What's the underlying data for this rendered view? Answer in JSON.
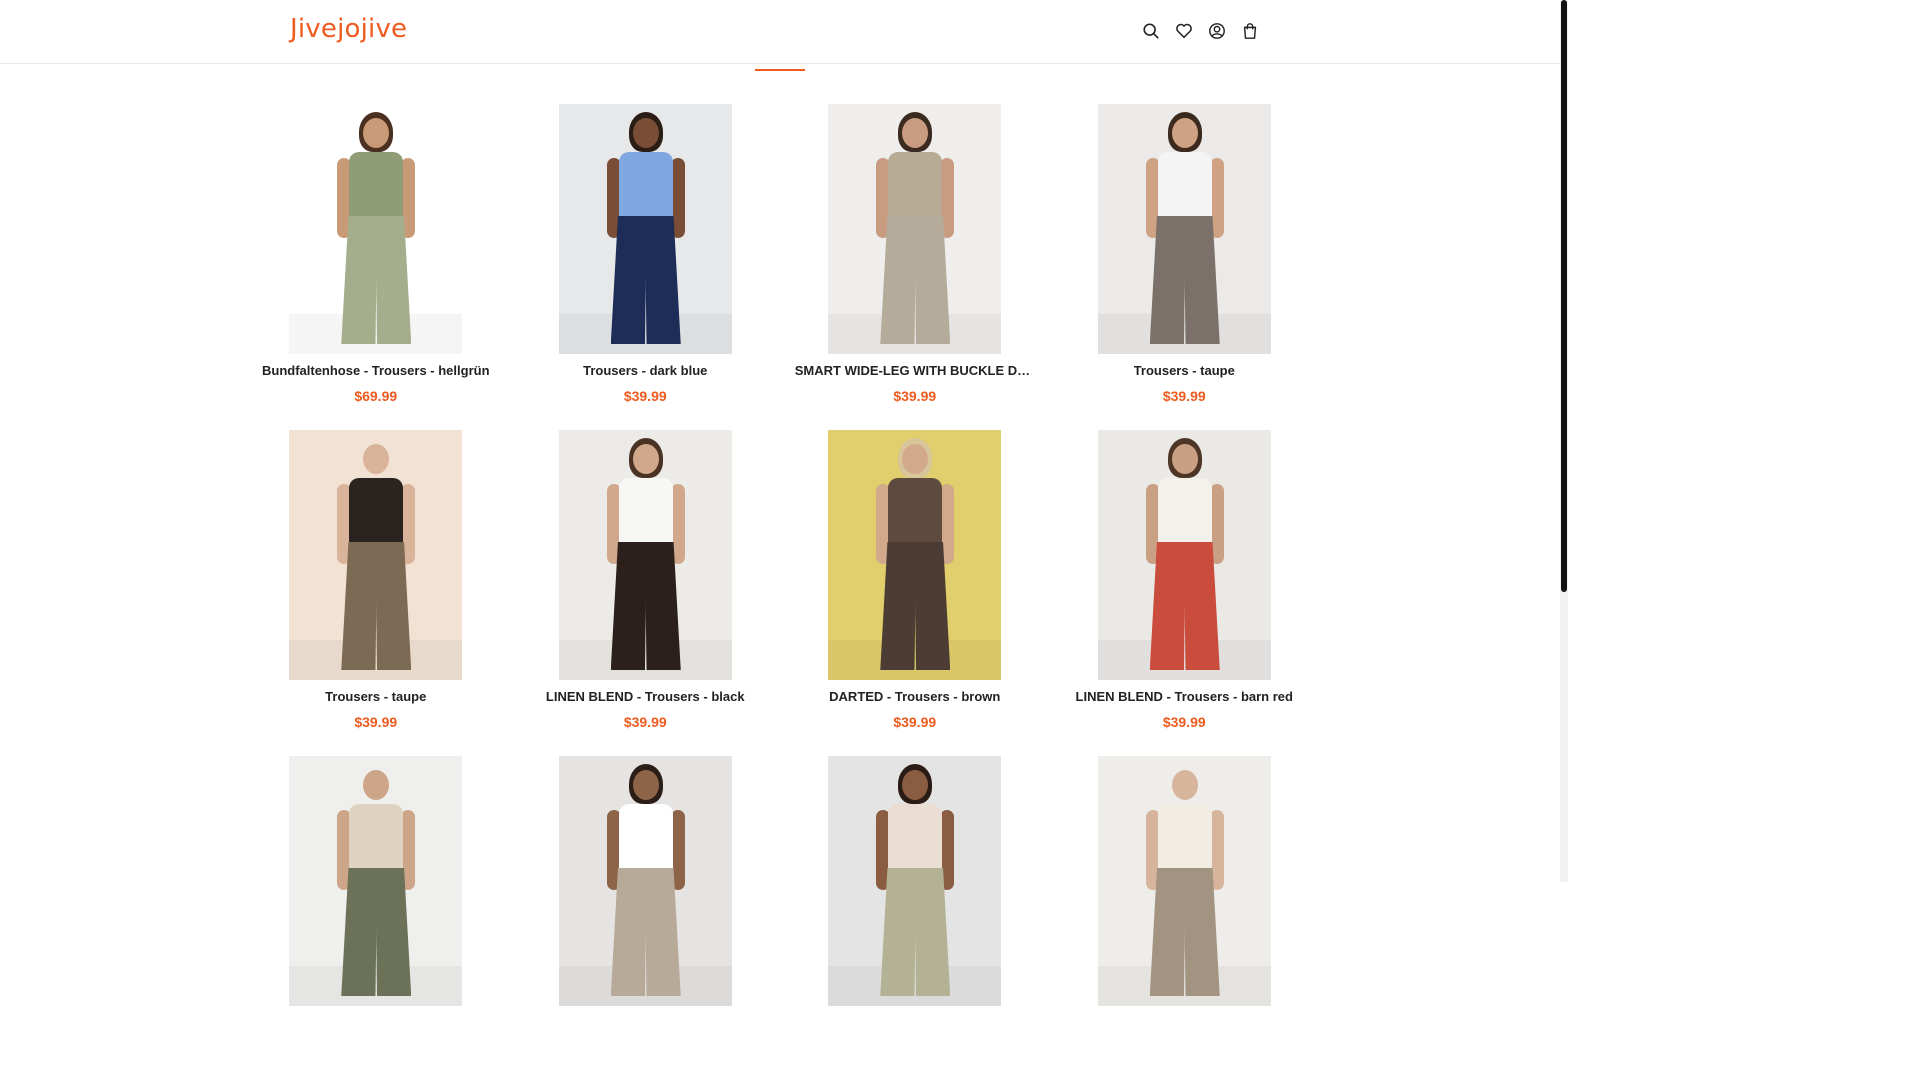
{
  "brand": {
    "name": "Jivejojive",
    "accent": "#ee5b1f"
  },
  "header": {
    "icons": [
      "search-icon",
      "heart-icon",
      "account-icon",
      "cart-icon"
    ]
  },
  "products": [
    {
      "title": "Bundfaltenhose - Trousers - hellgrün",
      "price": "$69.99",
      "bg": "#ffffff",
      "top": "#8f9c75",
      "pants": "#a4ad8c",
      "skin": "#c99a78",
      "hair": "#4a3021"
    },
    {
      "title": "Trousers - dark blue",
      "price": "$39.99",
      "bg": "#e7e8ea",
      "top": "#7fa7e0",
      "pants": "#1e2c58",
      "skin": "#7a4e36",
      "hair": "#2a1d16"
    },
    {
      "title": "SMART WIDE-LEG WITH BUCKLE DETAIL ...",
      "price": "$39.99",
      "bg": "#efeeec",
      "top": "#b8ab96",
      "pants": "#b5ab9a",
      "skin": "#c99c82",
      "hair": "#3a2a20"
    },
    {
      "title": "Trousers - taupe",
      "price": "$39.99",
      "bg": "#ebeae8",
      "top": "#f4f4f4",
      "pants": "#7b716a",
      "skin": "#cfa284",
      "hair": "#3c2a1e"
    },
    {
      "title": "Trousers - taupe",
      "price": "$39.99",
      "bg": "#f1e2d4",
      "top": "#2a2320",
      "pants": "#7d6a55",
      "skin": "#d9b39a",
      "hair": "#f1e2d4"
    },
    {
      "title": "LINEN BLEND - Trousers - black",
      "price": "$39.99",
      "bg": "#ecebe8",
      "top": "#f7f7f5",
      "pants": "#2c201c",
      "skin": "#d1a88c",
      "hair": "#4b3324"
    },
    {
      "title": "DARTED - Trousers - brown",
      "price": "$39.99",
      "bg": "#e1cf6d",
      "top": "#5e4a3e",
      "pants": "#4d3c33",
      "skin": "#d2a98a",
      "hair": "#d9c59a"
    },
    {
      "title": "LINEN BLEND - Trousers - barn red",
      "price": "$39.99",
      "bg": "#ebe9e6",
      "top": "#f4f1ea",
      "pants": "#c94c3d",
      "skin": "#c9a083",
      "hair": "#4e3626"
    },
    {
      "title": "",
      "price": "",
      "bg": "#efefed",
      "top": "#ded3c0",
      "pants": "#6b7258",
      "skin": "#cda68a",
      "hair": "#efefed"
    },
    {
      "title": "",
      "price": "",
      "bg": "#e6e4e2",
      "top": "#ffffff",
      "pants": "#b7aa99",
      "skin": "#8e6448",
      "hair": "#2b1e16"
    },
    {
      "title": "",
      "price": "",
      "bg": "#e4e4e4",
      "top": "#eaded4",
      "pants": "#b4b294",
      "skin": "#8a5d42",
      "hair": "#2a1c14"
    },
    {
      "title": "",
      "price": "",
      "bg": "#efedea",
      "top": "#f1ede3",
      "pants": "#a39381",
      "skin": "#d6b59c",
      "hair": "#efedea"
    }
  ]
}
